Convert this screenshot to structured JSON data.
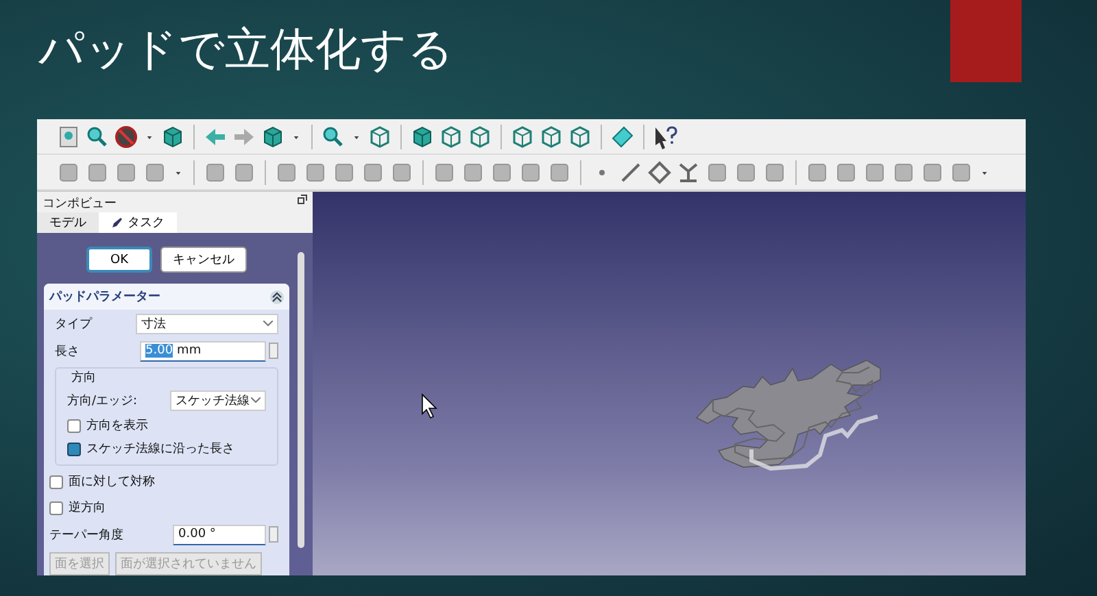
{
  "slide": {
    "title": "パッドで立体化する"
  },
  "panel": {
    "header": "コンポビュー",
    "tabs": [
      {
        "label": "モデル",
        "selected": false
      },
      {
        "label": "タスク",
        "selected": true
      }
    ],
    "buttons": [
      {
        "label": "OK",
        "selected": true
      },
      {
        "label": "キャンセル",
        "selected": false
      }
    ],
    "section_title": "パッドパラメーター",
    "type": {
      "label": "タイプ",
      "value": "寸法"
    },
    "length": {
      "label": "長さ",
      "value": "5.00",
      "unit": "mm"
    },
    "direction": {
      "title": "方向",
      "edge_label": "方向/エッジ:",
      "edge_value": "スケッチ法線",
      "checks": [
        {
          "label": "方向を表示",
          "checked": false
        },
        {
          "label": "スケッチ法線に沿った長さ",
          "checked": true
        }
      ]
    },
    "checks": [
      {
        "label": "面に対して対称",
        "checked": false
      },
      {
        "label": "逆方向",
        "checked": false
      }
    ],
    "taper": {
      "label": "テーパー角度",
      "value": "0.00 °"
    },
    "face_button": "面を選択",
    "face_status": "面が選択されていません"
  }
}
